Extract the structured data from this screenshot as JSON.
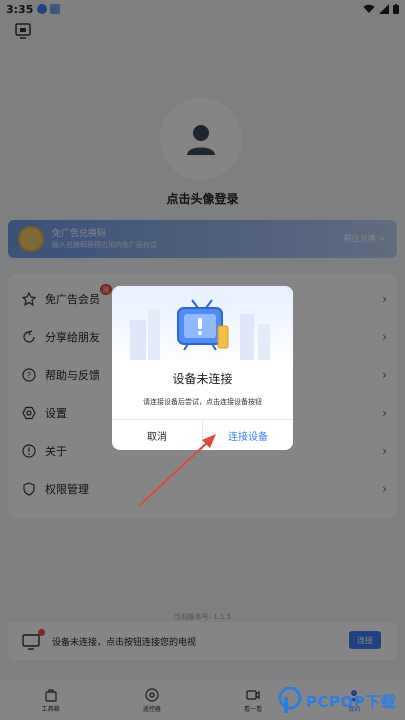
{
  "status_bar": {
    "time": "3:35"
  },
  "profile": {
    "login_prompt": "点击头像登录"
  },
  "promo": {
    "title": "免广告兑换码",
    "subtitle": "输入兑换码获得应用内免广告权益",
    "action": "前往兑换 >"
  },
  "menu": {
    "items": [
      {
        "label": "免广告会员",
        "icon": "vip-icon",
        "badge": "限"
      },
      {
        "label": "分享给朋友",
        "icon": "share-icon"
      },
      {
        "label": "帮助与反馈",
        "icon": "help-icon"
      },
      {
        "label": "设置",
        "icon": "settings-icon"
      },
      {
        "label": "关于",
        "icon": "info-icon"
      },
      {
        "label": "权限管理",
        "icon": "permission-icon"
      }
    ],
    "chevron": "›"
  },
  "version": "当前版本号: 1.1.5",
  "notice": {
    "text": "设备未连接，点击按钮连接您的电视",
    "button": "连接"
  },
  "tabs": [
    {
      "label": "工具箱",
      "icon": "toolbox-icon",
      "active": false
    },
    {
      "label": "遥控器",
      "icon": "remote-icon",
      "active": false
    },
    {
      "label": "看一看",
      "icon": "video-icon",
      "active": false
    },
    {
      "label": "我的",
      "icon": "profile-icon",
      "active": true
    }
  ],
  "dialog": {
    "title": "设备未连接",
    "description": "请连接设备后尝试，点击连接设备按钮",
    "cancel": "取消",
    "confirm": "连接设备"
  },
  "watermark": {
    "text": "PCPOP下载"
  },
  "colors": {
    "accent": "#3d7ff5",
    "badge": "#f14b4b",
    "arrow": "#e0493a"
  }
}
